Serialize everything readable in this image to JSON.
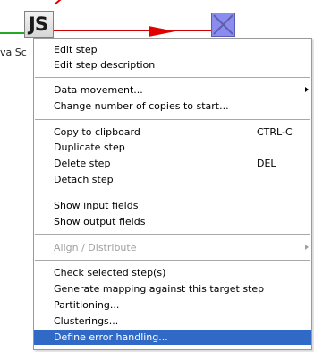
{
  "canvas": {
    "step_icon_text": "JS",
    "step_label": "va Sc",
    "colors": {
      "hop_line": "#d20000",
      "green_line": "#22aa22",
      "target_icon": "#8a8cf0"
    }
  },
  "menu": {
    "edit_step": "Edit step",
    "edit_step_description": "Edit step description",
    "data_movement": "Data movement...",
    "change_copies": "Change number of copies to start...",
    "copy_to_clipboard": "Copy to clipboard",
    "copy_shortcut": "CTRL-C",
    "duplicate_step": "Duplicate step",
    "delete_step": "Delete step",
    "delete_shortcut": "DEL",
    "detach_step": "Detach step",
    "show_input_fields": "Show input fields",
    "show_output_fields": "Show output fields",
    "align_distribute": "Align / Distribute",
    "check_selected": "Check selected step(s)",
    "generate_mapping": "Generate mapping against this target step",
    "partitioning": "Partitioning...",
    "clusterings": "Clusterings...",
    "define_error_handling": "Define error handling...",
    "colors": {
      "selected_bg": "#3169c6",
      "disabled_text": "#a0a0a0"
    }
  }
}
